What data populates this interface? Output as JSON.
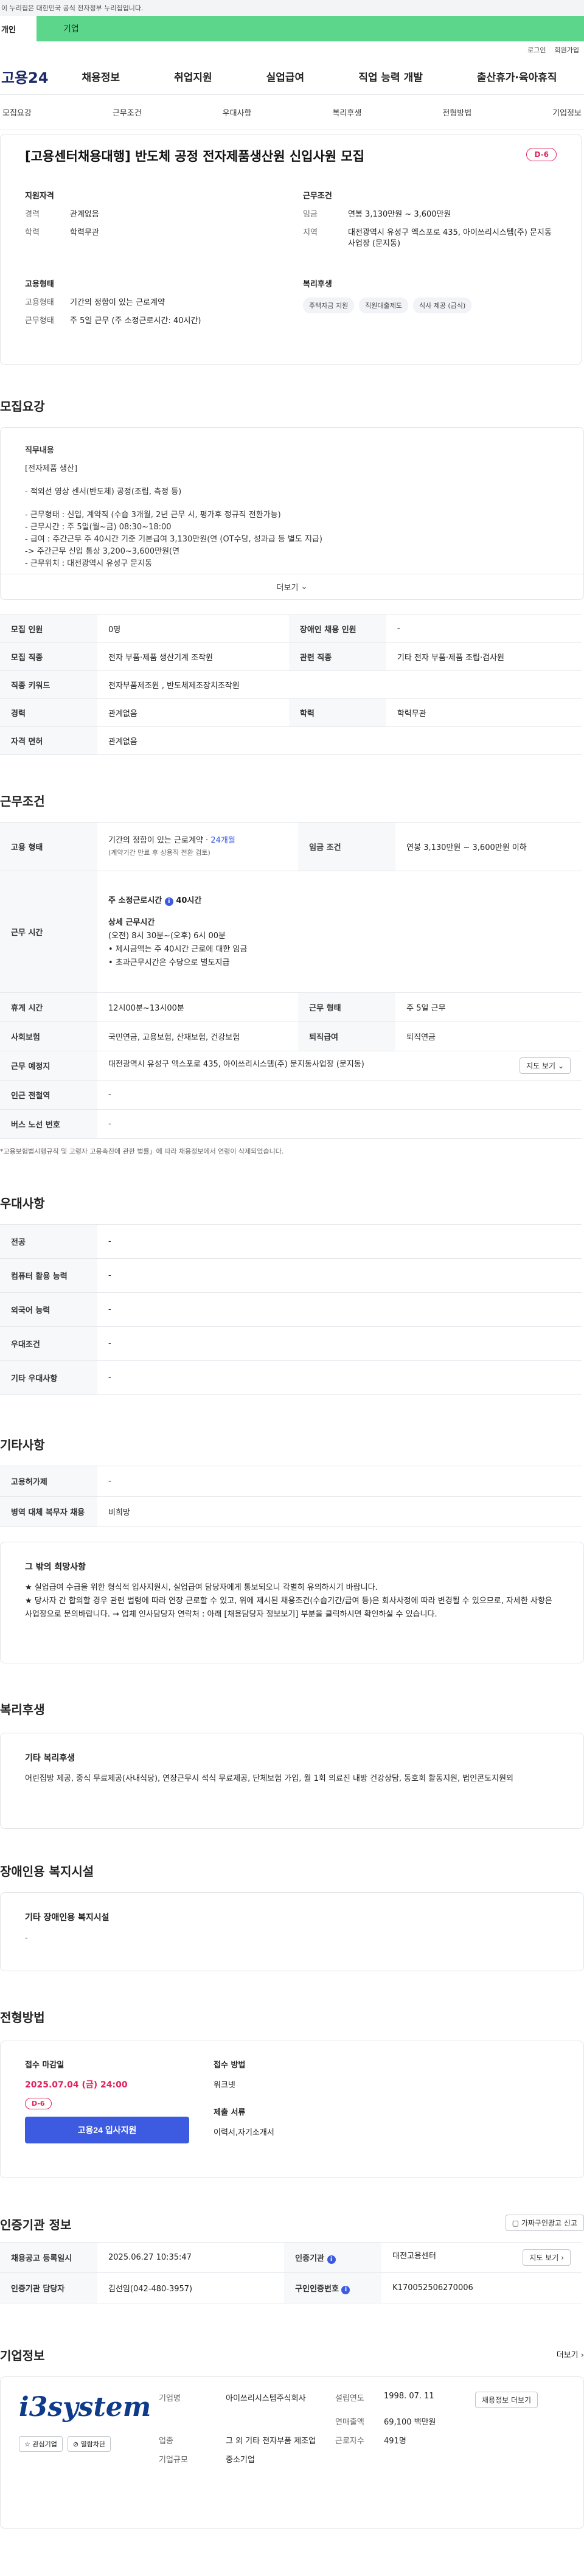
{
  "top_banner": "이 누리집은 대한민국 공식 전자정부 누리집입니다.",
  "gnb_tabs": [
    "개인",
    "기업"
  ],
  "util": [
    "로그인",
    "회원가입"
  ],
  "logo": "고용24",
  "main_nav": [
    "채용정보",
    "취업지원",
    "실업급여",
    "직업 능력 개발",
    "출산휴가·육아휴직"
  ],
  "sub_nav": [
    "모집요강",
    "근무조건",
    "우대사항",
    "복리후생",
    "전형방법",
    "기업정보"
  ],
  "job": {
    "title": "[고용센터채용대행] 반도체 공정 전자제품생산원 신입사원 모집",
    "dday": "D-6",
    "applicant_title": "지원자격",
    "applicant": [
      {
        "k": "경력",
        "v": "관계없음"
      },
      {
        "k": "학력",
        "v": "학력무관"
      }
    ],
    "work_title": "근무조건",
    "work": [
      {
        "k": "임금",
        "v": "연봉 3,130만원 ~ 3,600만원"
      },
      {
        "k": "지역",
        "v": "대전광역시 유성구 엑스포로 435, 아이쓰리시스템(주) 문지동사업장 (문지동)"
      }
    ],
    "emp_title": "고용형태",
    "emp": [
      {
        "k": "고용형태",
        "v": "기간의 정함이 있는 근로계약"
      },
      {
        "k": "근무형태",
        "v": "주 5일 근무 (주 소정근로시간: 40시간)"
      }
    ],
    "welfare_title": "복리후생",
    "welfare_chips": [
      "주택자금 지원",
      "직원대출제도",
      "식사 제공 (급식)"
    ]
  },
  "requirements": {
    "title": "모집요강",
    "lines": [
      "직무내용",
      "[전자제품 생산]",
      "- 적외선 영상 센서(반도체) 공정(조립, 측정 등)",
      "- 근무형태 : 신입, 계약직 (수습 3개월, 2년 근무 시, 평가후 정규직 전환가능)",
      "- 근무시간 : 주 5일(월~금) 08:30~18:00",
      "- 급여 : 주간근무 주 40시간 기준 기본급여 3,130만원(연 (OT수당, 성과급 등 별도 지급)",
      "-> 주간근무 신입 통상 3,200~3,600만원(연",
      "- 근무위치 : 대전광역시 유성구 문지동"
    ],
    "more": "더보기"
  },
  "req_table": {
    "rows": [
      [
        {
          "th": "모집 인원"
        },
        {
          "td": "0명"
        },
        {
          "th": "장애인 채용 인원"
        },
        {
          "td": "-"
        }
      ],
      [
        {
          "th": "모집 직종"
        },
        {
          "td": "전자 부품·제품 생산기계 조작원"
        },
        {
          "th": "관련 직종"
        },
        {
          "td": "기타 전자 부품·제품 조립·검사원"
        }
      ],
      [
        {
          "th": "직종 키워드"
        },
        {
          "td": "전자부품제조원 , 반도체제조장치조작원",
          "span": 3
        }
      ],
      [
        {
          "th": "경력"
        },
        {
          "td": "관계없음"
        },
        {
          "th": "학력"
        },
        {
          "td": "학력무관"
        }
      ],
      [
        {
          "th": "자격 면허"
        },
        {
          "td": "관계없음",
          "span": 3
        }
      ]
    ]
  },
  "work_conditions": {
    "title": "근무조건",
    "emp_type_th": "고용 형태",
    "emp_type": "기간의 정함이 있는 근로계약 · ",
    "emp_type_link": "24개월",
    "emp_type_note": "(계약기간 만료 후 상용직 전환 검토)",
    "wage_th": "임금 조건",
    "wage": "연봉 3,130만원 ~ 3,600만원 이하",
    "hours_th": "근무 시간",
    "hours_main_label": "주 소정근로시간",
    "hours_main_value": "40시간",
    "hours_detail_title": "상세 근무시간",
    "hours_detail": "(오전) 8시 30분~(오후) 6시 00분",
    "hours_bullets": [
      "제시금액는 주 40시간 근로에 대한 임금",
      "초과근무시간은 수당으로 별도지급"
    ],
    "break_th": "휴게 시간",
    "break": "12시00분~13시00분",
    "form_th": "근무 형태",
    "form": "주 5일 근무",
    "ins_th": "사회보험",
    "ins": "국민연금, 고용보험, 산재보험, 건강보험",
    "retire_th": "퇴직급여",
    "retire": "퇴직연금",
    "place_th": "근무 예정지",
    "place": "대전광역시 유성구 엑스포로 435, 아이쓰리시스템(주) 문지동사업장 (문지동)",
    "map_btn": "지도 보기",
    "subway_th": "인근 전철역",
    "subway": "-",
    "bus_th": "버스 노선 번호",
    "bus": "-",
    "note": "*고용보험법시행규칙 및 고령자 고용촉진에 관한 법률」에 따라 채용정보에서 연령이 삭제되었습니다."
  },
  "preferences": {
    "title": "우대사항",
    "rows": [
      {
        "th": "전공",
        "td": "-"
      },
      {
        "th": "컴퓨터 활용 능력",
        "td": "-"
      },
      {
        "th": "외국어 능력",
        "td": "-"
      },
      {
        "th": "우대조건",
        "td": "-"
      },
      {
        "th": "기타 우대사항",
        "td": "-"
      }
    ]
  },
  "etc": {
    "title": "기타사항",
    "rows": [
      {
        "th": "고용허가제",
        "td": "-"
      },
      {
        "th": "병역 대체 복무자 채용",
        "td": "비희망"
      }
    ],
    "box_title": "그 밖의 희망사항",
    "box_lines": [
      "★ 실업급여 수급을 위한 형식적 입사지원시, 실업급여 담당자에게 통보되오니 각별히 유의하시기 바랍니다.",
      "★ 당사자 간 합의할 경우 관련 법령에 따라 연장 근로할 수 있고, 위에 제시된 채용조건(수습기간/급여 등)은 회사사정에 따라 변경될 수 있으므로, 자세한 사항은 사업장으로 문의바랍니다. → 업체 인사담당자 연락처 : 아래 [채용담당자 정보보기] 부분을 클릭하시면 확인하실 수 있습니다."
    ]
  },
  "benefits": {
    "title": "복리후생",
    "box_title": "기타 복리후생",
    "text": "어린집방 제공, 중식 무료제공(사내식당), 연장근무시 석식 무료제공, 단체보험 가입, 월 1회 의료진 내방 건강상담, 동호회 활동지원, 법인콘도지원외"
  },
  "disabled": {
    "title": "장애인용 복지시설",
    "box_title": "기타 장애인용 복지시설",
    "text": "-"
  },
  "apply": {
    "title": "전형방법",
    "deadline_title": "접수 마감일",
    "deadline": "2025.07.04 (금) 24:00",
    "dday": "D-6",
    "button": "고용24 입사지원",
    "method_title": "접수 방법",
    "method": "워크넷",
    "docs_title": "제출 서류",
    "docs": "이력서,자기소개서"
  },
  "cert": {
    "title": "인증기관 정보",
    "btn": "가짜구인광고 신고",
    "rows": [
      [
        {
          "th": "채용공고 등록일시"
        },
        {
          "td": "2025.06.27 10:35:47"
        },
        {
          "th": "인증기관"
        },
        {
          "td": "대전고용센터"
        }
      ],
      [
        {
          "th": "인증기관 담당자"
        },
        {
          "td": "김선임(042-480-3957)"
        },
        {
          "th": "구인인증번호"
        },
        {
          "td": "K170052506270006"
        }
      ]
    ],
    "map_btn": "지도 보기"
  },
  "company": {
    "title": "기업정보",
    "more": "더보기",
    "logo_text": "i3system",
    "logo_sub": "",
    "btn_like": "관심기업",
    "btn_block": "열람차단",
    "fields": [
      {
        "k": "기업명",
        "v": "아이쓰리시스템주식회사"
      },
      {
        "k": "설립연도",
        "v": "1998. 07. 11"
      },
      {
        "k": "연매출액",
        "v": "69,100 백만원"
      },
      {
        "k": "업종",
        "v": "그 외 기타 전자부품 제조업"
      },
      {
        "k": "근로자수",
        "v": "491명"
      },
      {
        "k": "기업규모",
        "v": "중소기업"
      }
    ],
    "recruit_btn": "채용정보 더보기"
  }
}
